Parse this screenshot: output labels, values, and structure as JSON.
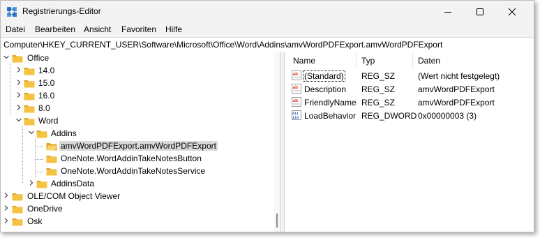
{
  "window": {
    "title": "Registrierungs-Editor",
    "controls": [
      "minimize",
      "maximize",
      "close"
    ]
  },
  "menu": {
    "items": [
      "Datei",
      "Bearbeiten",
      "Ansicht",
      "Favoriten",
      "Hilfe"
    ]
  },
  "address": {
    "path": "Computer\\HKEY_CURRENT_USER\\Software\\Microsoft\\Office\\Word\\Addins\\amvWordPDFExport.amvWordPDFExport"
  },
  "tree": {
    "nodes": [
      {
        "label": "Office",
        "expander": "expanded"
      },
      {
        "label": "14.0",
        "expander": "collapsed"
      },
      {
        "label": "15.0",
        "expander": "collapsed"
      },
      {
        "label": "16.0",
        "expander": "collapsed"
      },
      {
        "label": "8.0",
        "expander": "collapsed"
      },
      {
        "label": "Word",
        "expander": "expanded"
      },
      {
        "label": "Addins",
        "expander": "expanded"
      },
      {
        "label": "amvWordPDFExport.amvWordPDFExport",
        "expander": "none",
        "selected": true
      },
      {
        "label": "OneNote.WordAddinTakeNotesButton",
        "expander": "none"
      },
      {
        "label": "OneNote.WordAddinTakeNotesService",
        "expander": "none"
      },
      {
        "label": "AddinsData",
        "expander": "collapsed"
      },
      {
        "label": "OLE/COM Object Viewer",
        "expander": "collapsed"
      },
      {
        "label": "OneDrive",
        "expander": "collapsed"
      },
      {
        "label": "Osk",
        "expander": "collapsed"
      }
    ]
  },
  "values": {
    "columns": [
      "Name",
      "Typ",
      "Daten"
    ],
    "rows": [
      {
        "icon": "string-value-icon",
        "name": "(Standard)",
        "type": "REG_SZ",
        "data": "(Wert nicht festgelegt)"
      },
      {
        "icon": "string-value-icon",
        "name": "Description",
        "type": "REG_SZ",
        "data": "amvWordPDFExport"
      },
      {
        "icon": "string-value-icon",
        "name": "FriendlyName",
        "type": "REG_SZ",
        "data": "amvWordPDFExport"
      },
      {
        "icon": "binary-value-icon",
        "name": "LoadBehavior",
        "type": "REG_DWORD",
        "data": "0x00000003 (3)"
      }
    ]
  },
  "colors": {
    "folder": "#f5c342",
    "folder_dark": "#e0a424",
    "selection": "#d9d9d9",
    "string_icon": "#d83b1c",
    "binary_icon": "#2a5fb0"
  }
}
